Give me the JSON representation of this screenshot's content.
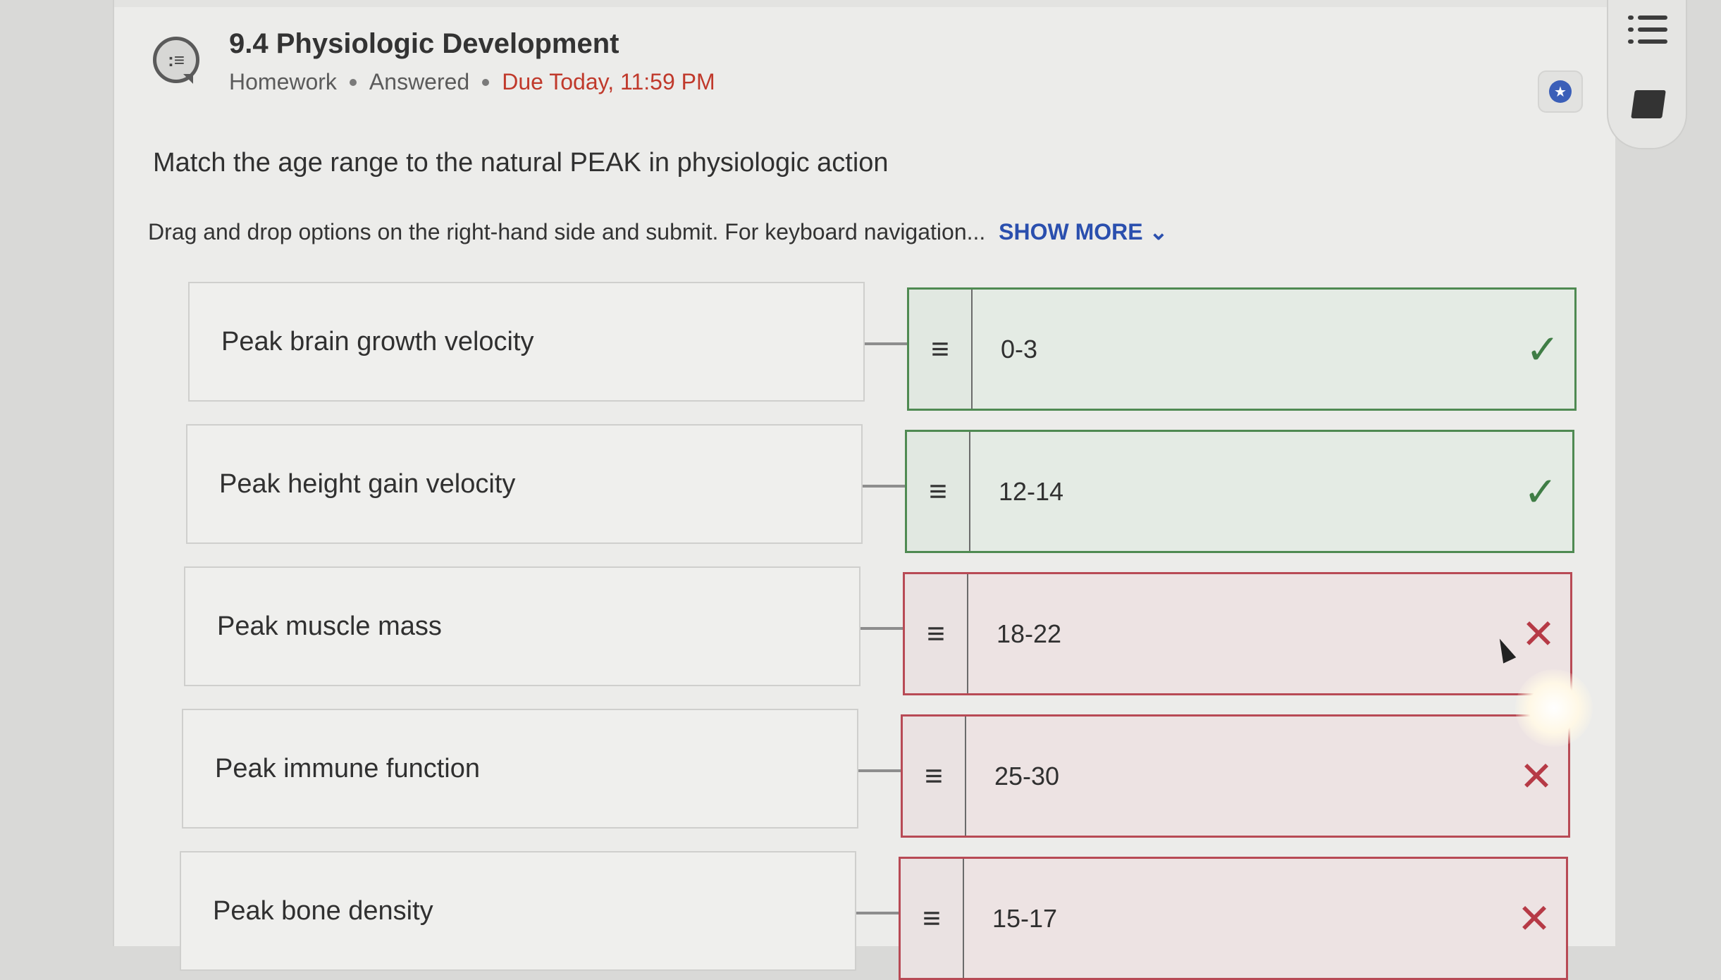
{
  "header": {
    "title": "9.4 Physiologic Development",
    "type": "Homework",
    "status": "Answered",
    "due": "Due Today, 11:59 PM"
  },
  "question": "Match the age range to the natural PEAK in physiologic action",
  "instructions": "Drag and drop options on the right-hand side and submit. For keyboard navigation...",
  "show_more": "SHOW MORE",
  "pairs": [
    {
      "prompt": "Peak brain growth velocity",
      "answer": "0-3",
      "result": "correct"
    },
    {
      "prompt": "Peak height gain velocity",
      "answer": "12-14",
      "result": "correct"
    },
    {
      "prompt": "Peak muscle mass",
      "answer": "18-22",
      "result": "incorrect"
    },
    {
      "prompt": "Peak immune function",
      "answer": "25-30",
      "result": "incorrect"
    },
    {
      "prompt": "Peak bone density",
      "answer": "15-17",
      "result": "incorrect"
    }
  ],
  "icons": {
    "header": "assignment-list-icon",
    "badge": "star-badge-icon",
    "drag": "drag-handle-icon",
    "correct": "checkmark-icon",
    "incorrect": "x-mark-icon",
    "sidebar_top": "table-of-contents-icon",
    "sidebar_bottom": "book-icon"
  },
  "colors": {
    "correct_border": "#4f8a52",
    "incorrect_border": "#b84a55",
    "due_text": "#c0392b",
    "link": "#2a4fae"
  }
}
